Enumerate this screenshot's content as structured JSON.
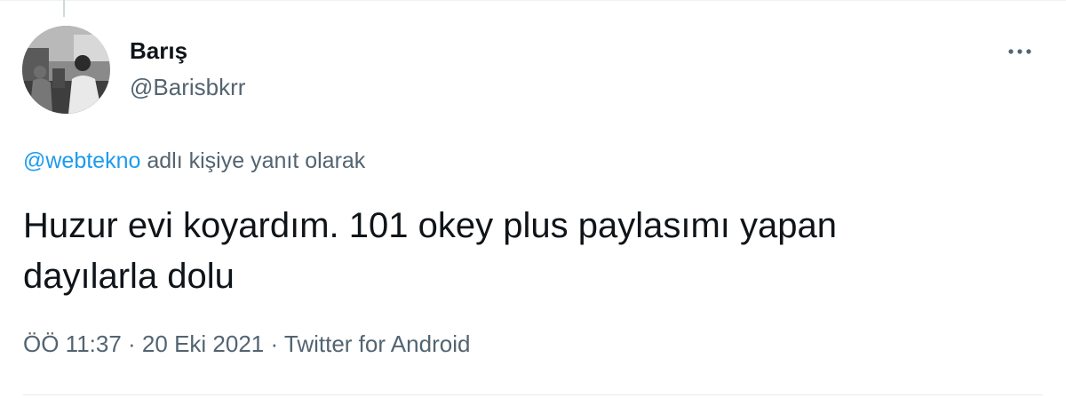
{
  "tweet": {
    "author": {
      "display_name": "Barış",
      "handle": "@Barisbkrr",
      "avatar_icon": "avatar-photo"
    },
    "more_icon": "more-horizontal-icon",
    "reply_context": {
      "mention": "@webtekno",
      "suffix": " adlı kişiye yanıt olarak"
    },
    "text_lines": [
      "Huzur evi koyardım. 101 okey plus paylasımı yapan",
      "dayılarla dolu"
    ],
    "meta": {
      "time": "ÖÖ 11:37",
      "separator": " · ",
      "date": "20 Eki 2021",
      "source": "Twitter for Android"
    }
  },
  "colors": {
    "text": "#0f1419",
    "secondary": "#536471",
    "accent": "#1d9bf0",
    "divider": "#e6ecf0"
  }
}
